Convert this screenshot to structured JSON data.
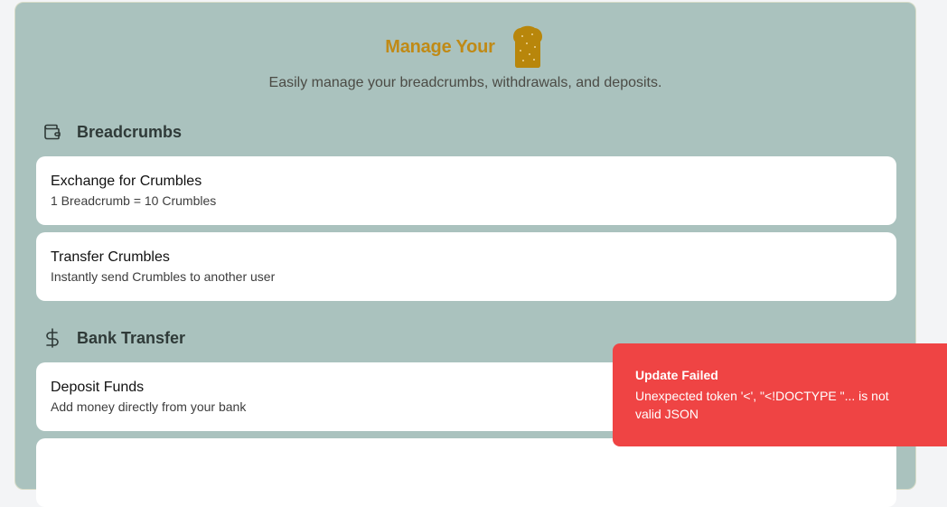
{
  "header": {
    "title": "Manage Your",
    "title_icon": "bread-toast-icon",
    "subtitle": "Easily manage your breadcrumbs, withdrawals, and deposits."
  },
  "sections": [
    {
      "heading": "Breadcrumbs",
      "icon": "wallet-icon",
      "cards": [
        {
          "title": "Exchange for Crumbles",
          "description": "1 Breadcrumb = 10 Crumbles"
        },
        {
          "title": "Transfer Crumbles",
          "description": "Instantly send Crumbles to another user"
        }
      ]
    },
    {
      "heading": "Bank Transfer",
      "icon": "dollar-icon",
      "cards": [
        {
          "title": "Deposit Funds",
          "description": "Add money directly from your bank"
        }
      ]
    }
  ],
  "toast": {
    "title": "Update Failed",
    "message": "Unexpected token '<', \"<!DOCTYPE \"... is not valid JSON"
  },
  "colors": {
    "panel_bg": "#aac2be",
    "accent": "#c08a16",
    "toast_bg": "#ef4444"
  }
}
